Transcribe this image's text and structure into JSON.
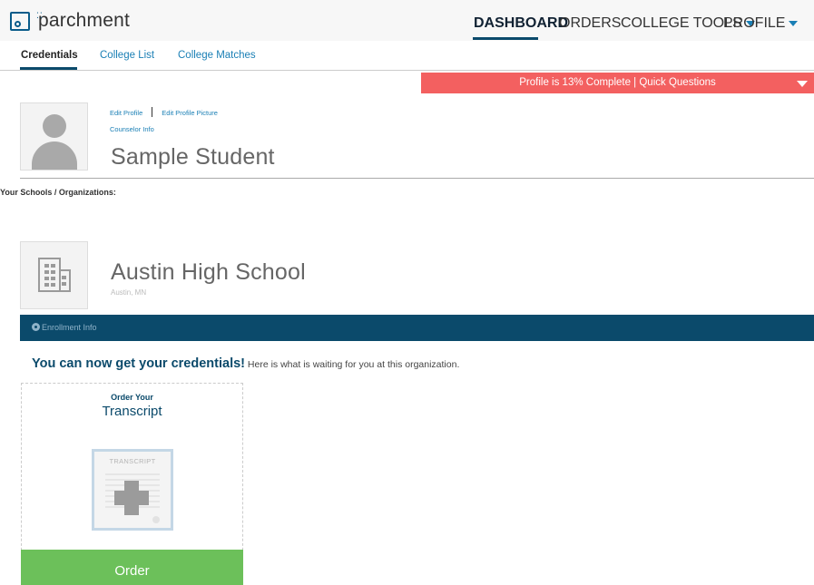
{
  "header": {
    "logo_text": "parchment",
    "nav": [
      {
        "label": "DASHBOARD",
        "active": true
      },
      {
        "label": "ORDERS"
      },
      {
        "label": "COLLEGE TOOLS",
        "dropdown": true
      },
      {
        "label": "PROFILE",
        "dropdown": true
      }
    ]
  },
  "subtabs": [
    {
      "label": "Credentials",
      "active": true
    },
    {
      "label": "College List"
    },
    {
      "label": "College Matches"
    }
  ],
  "banner": {
    "text": "Profile is 13% Complete | Quick Questions",
    "progress_percent": 13
  },
  "profile": {
    "edit_profile": "Edit Profile",
    "edit_picture": "Edit Profile Picture",
    "counselor_info": "Counselor Info",
    "name": "Sample Student"
  },
  "schools_label": "Your Schools / Organizations:",
  "school": {
    "name": "Austin High School",
    "location": "Austin, MN",
    "enrollment_label": "Enrollment Info"
  },
  "credentials": {
    "headline": "You can now get your credentials!",
    "subtext": " Here is what is waiting for you at this organization."
  },
  "card": {
    "small_title": "Order Your",
    "title": "Transcript",
    "doc_label": "TRANSCRIPT",
    "button_label": "Order"
  },
  "colors": {
    "brand_navy": "#0b4a6b",
    "link_blue": "#1a7fb5",
    "banner_red": "#f36060",
    "order_green": "#6cc05a"
  }
}
